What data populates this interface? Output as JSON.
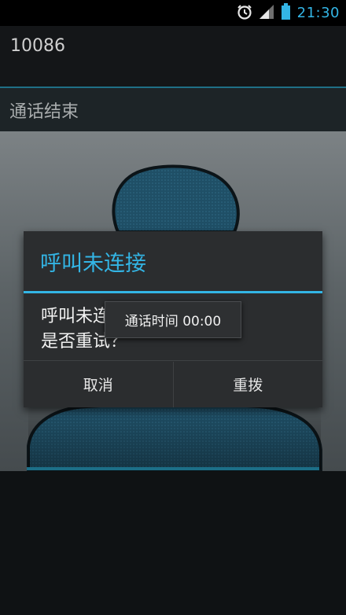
{
  "status_bar": {
    "time": "21:30",
    "icons": [
      "alarm-icon",
      "signal-icon",
      "battery-icon"
    ]
  },
  "caller": {
    "number": "10086"
  },
  "call_state": {
    "label": "通话结束"
  },
  "dialog": {
    "title": "呼叫未连接",
    "message_line1": "呼叫未连接。",
    "message_line2": "是否重试？",
    "cancel_label": "取消",
    "redial_label": "重拨"
  },
  "toast": {
    "text": "通话时间 00:00"
  },
  "colors": {
    "accent": "#33b5e5",
    "dialog_bg": "#2b2d2f",
    "status_bg": "#000000"
  }
}
